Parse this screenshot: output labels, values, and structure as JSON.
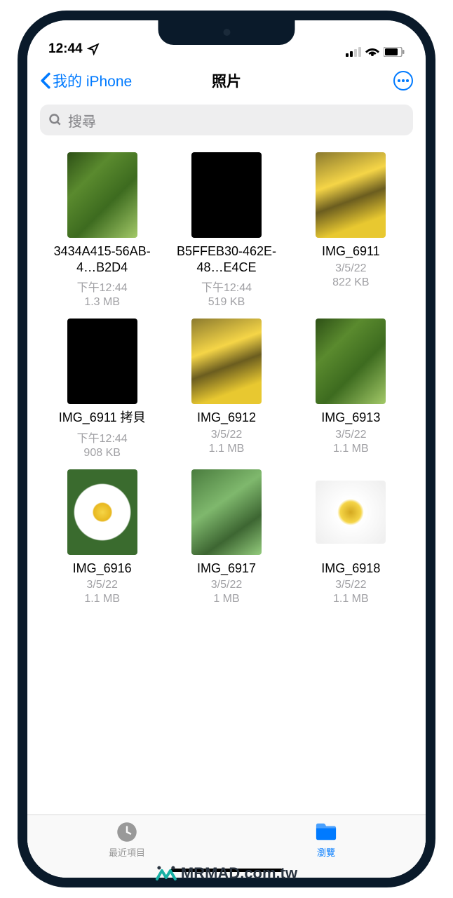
{
  "status": {
    "time": "12:44",
    "location_icon": "location-arrow",
    "cellular": "2-bars",
    "wifi": "full",
    "battery": "75"
  },
  "nav": {
    "back_label": "我的 iPhone",
    "title": "照片",
    "more": "more"
  },
  "search": {
    "placeholder": "搜尋"
  },
  "files": [
    {
      "name": "3434A415-56AB-4…B2D4",
      "date": "下午12:44",
      "size": "1.3 MB",
      "thumb": "green-leaves"
    },
    {
      "name": "B5FFEB30-462E-48…E4CE",
      "date": "下午12:44",
      "size": "519 KB",
      "thumb": "black"
    },
    {
      "name": "IMG_6911",
      "date": "3/5/22",
      "size": "822 KB",
      "thumb": "yellow-flower"
    },
    {
      "name": "IMG_6911 拷貝",
      "date": "下午12:44",
      "size": "908 KB",
      "thumb": "black"
    },
    {
      "name": "IMG_6912",
      "date": "3/5/22",
      "size": "1.1 MB",
      "thumb": "yellow-flower"
    },
    {
      "name": "IMG_6913",
      "date": "3/5/22",
      "size": "1.1 MB",
      "thumb": "green-leaves"
    },
    {
      "name": "IMG_6916",
      "date": "3/5/22",
      "size": "1.1 MB",
      "thumb": "daisy-bg"
    },
    {
      "name": "IMG_6917",
      "date": "3/5/22",
      "size": "1 MB",
      "thumb": "succulents"
    },
    {
      "name": "IMG_6918",
      "date": "3/5/22",
      "size": "1.1 MB",
      "thumb": "daisy-zoom"
    }
  ],
  "tabs": {
    "recent": "最近項目",
    "browse": "瀏覽"
  },
  "watermark": "MRMAD.com.tw"
}
